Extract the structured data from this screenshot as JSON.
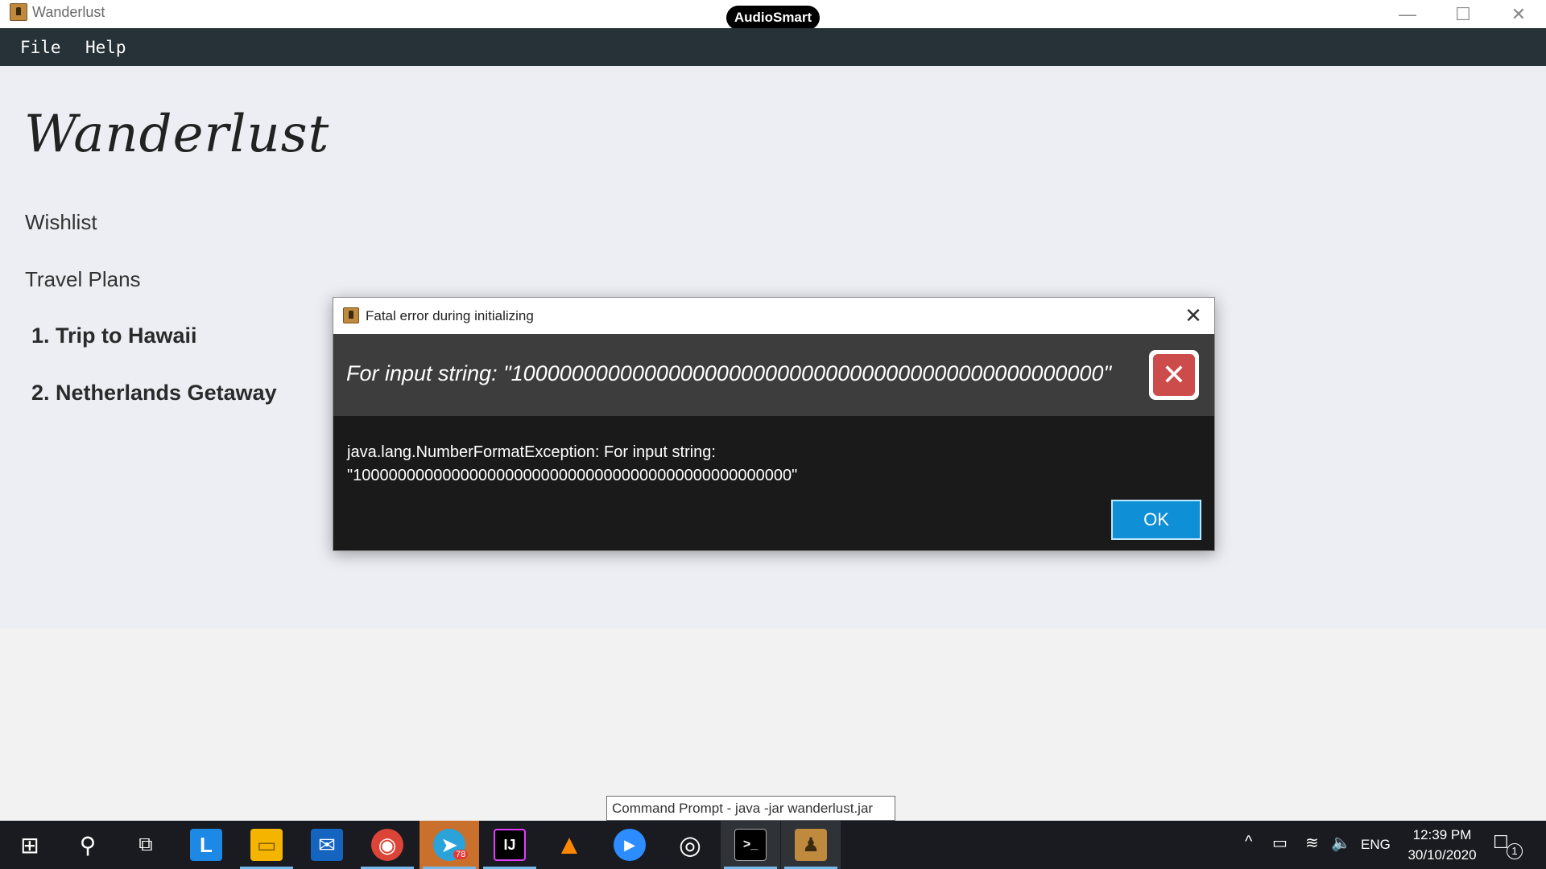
{
  "window": {
    "title": "Wanderlust",
    "overlay_badge": "AudioSmart",
    "controls": {
      "minimize": "—",
      "maximize": "☐",
      "close": "✕"
    }
  },
  "menubar": {
    "items": [
      {
        "label": "File"
      },
      {
        "label": "Help"
      }
    ]
  },
  "sidebar": {
    "logo": "Wanderlust",
    "links": [
      {
        "label": "Wishlist"
      },
      {
        "label": "Travel Plans"
      }
    ],
    "plans": [
      {
        "label": "1.  Trip to Hawaii"
      },
      {
        "label": "2.  Netherlands Getaway"
      }
    ]
  },
  "dialog": {
    "title": "Fatal error during initializing",
    "header": "For input string: \"1000000000000000000000000000000000000000000000000\"",
    "body_line1": "java.lang.NumberFormatException: For input string:",
    "body_line2": "\"1000000000000000000000000000000000000000000000000\"",
    "ok_label": "OK",
    "close_glyph": "✕",
    "error_glyph": "✕"
  },
  "tooltip": {
    "text": "Command Prompt - java  -jar wanderlust.jar"
  },
  "taskbar": {
    "apps": [
      {
        "name": "start",
        "glyph": "⊞"
      },
      {
        "name": "search",
        "glyph": "⚲"
      },
      {
        "name": "task-view",
        "glyph": "⧉"
      },
      {
        "name": "l-app",
        "glyph": "L"
      },
      {
        "name": "file-explorer",
        "glyph": "▭"
      },
      {
        "name": "mail",
        "glyph": "✉"
      },
      {
        "name": "chrome",
        "glyph": "◉"
      },
      {
        "name": "telegram",
        "glyph": "➤",
        "badge": "78"
      },
      {
        "name": "intellij",
        "glyph": "IJ"
      },
      {
        "name": "vlc",
        "glyph": "▲"
      },
      {
        "name": "zoom",
        "glyph": "▶"
      },
      {
        "name": "lens",
        "glyph": "◎"
      },
      {
        "name": "command-prompt",
        "glyph": ">_"
      },
      {
        "name": "wanderlust",
        "glyph": "♟"
      }
    ],
    "tray": {
      "chevron": "^",
      "battery": "▭",
      "wifi": "≋",
      "volume": "🔈",
      "language": "ENG"
    },
    "clock": {
      "time": "12:39 PM",
      "date": "30/10/2020"
    },
    "notifications": {
      "glyph": "☐",
      "count": "1"
    }
  },
  "colors": {
    "menubar": "#263238",
    "content_bg": "#eceef4",
    "dialog_header": "#3d3d3d",
    "dialog_body": "#1a1a1a",
    "error_red": "#cc4b4b",
    "ok_blue": "#0f8fd6",
    "taskbar": "#191b20"
  }
}
